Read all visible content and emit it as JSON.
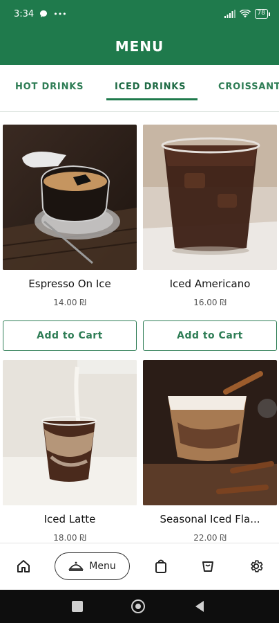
{
  "status_bar": {
    "time": "3:34",
    "battery": "78"
  },
  "header": {
    "title": "MENU"
  },
  "tabs": [
    {
      "label": "HOT DRINKS"
    },
    {
      "label": "ICED DRINKS"
    },
    {
      "label": "CROISSANT"
    }
  ],
  "products": [
    {
      "name": "Espresso On Ice",
      "price": "14.00 ₪",
      "cta": "Add to Cart"
    },
    {
      "name": "Iced Americano",
      "price": "16.00 ₪",
      "cta": "Add to Cart"
    },
    {
      "name": "Iced Latte",
      "price": "18.00 ₪"
    },
    {
      "name": "Seasonal  Iced Fla...",
      "price": "22.00 ₪"
    }
  ],
  "bottom_nav": {
    "menu_label": "Menu",
    "icons": [
      "home-icon",
      "menu-icon",
      "shopping-bag-icon",
      "cart-icon",
      "settings-icon"
    ]
  },
  "colors": {
    "primary": "#1f7a4c",
    "accent_text": "#2e7d55"
  }
}
